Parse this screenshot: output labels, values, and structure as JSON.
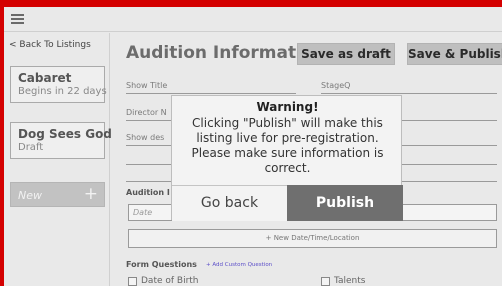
{
  "sidebar": {
    "back_label": "< Back To Listings",
    "listings": [
      {
        "title": "Cabaret",
        "subtitle": "Begins in 22 days"
      },
      {
        "title": "Dog Sees God",
        "subtitle": "Draft"
      }
    ],
    "new_label": "New",
    "new_plus": "+"
  },
  "main": {
    "heading": "Audition Information",
    "save_draft_label": "Save as draft",
    "save_publish_label": "Save & Publish",
    "fields": {
      "show_title": "Show Title",
      "stage": "StageQ",
      "director": "Director N",
      "show_desc": "Show des"
    },
    "audition_label": "Audition I",
    "date_placeholder": "Date",
    "new_date_label": "+ New Date/Time/Location",
    "form_questions_label": "Form Questions",
    "add_custom_label": "+ Add Custom Question",
    "questions": [
      "Date of Birth",
      "Talents"
    ]
  },
  "modal": {
    "title": "Warning!",
    "message": "Clicking \"Publish\" will make this listing live for pre-registration. Please make sure information is correct.",
    "go_back_label": "Go back",
    "publish_label": "Publish"
  }
}
